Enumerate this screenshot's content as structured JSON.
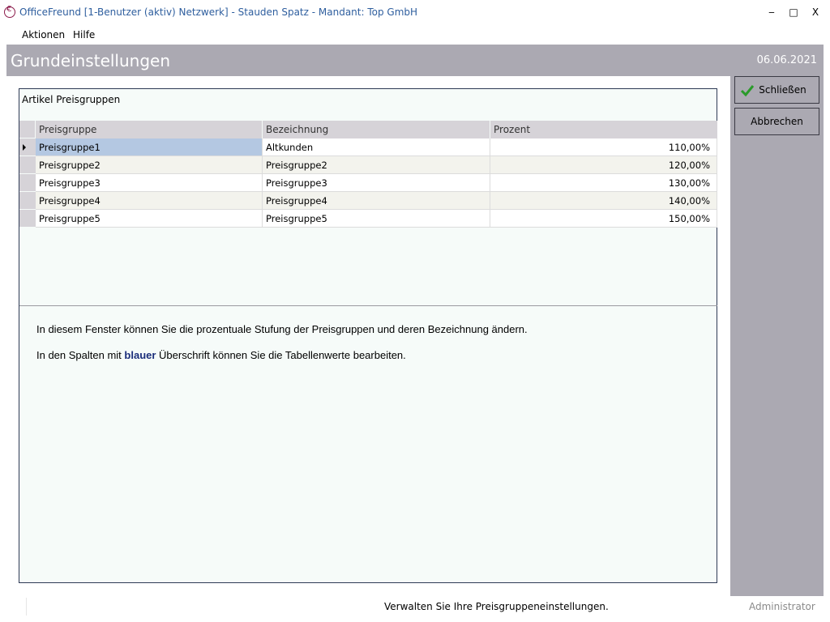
{
  "window": {
    "title": "OfficeFreund [1-Benutzer (aktiv) Netzwerk]  -  Stauden Spatz  -  Mandant: Top GmbH",
    "minimize_glyph": "‒",
    "maximize_glyph": "□",
    "close_glyph": "X"
  },
  "menu": {
    "items": [
      "Aktionen",
      "Hilfe"
    ]
  },
  "header": {
    "title": "Grundeinstellungen",
    "date": "06.06.2021"
  },
  "sidebar": {
    "close_label": "Schließen",
    "cancel_label": "Abbrechen"
  },
  "group": {
    "label": "Artikel Preisgruppen"
  },
  "table": {
    "columns": [
      "Preisgruppe",
      "Bezeichnung",
      "Prozent"
    ],
    "rows": [
      [
        "Preisgruppe1",
        "Altkunden",
        "110,00%"
      ],
      [
        "Preisgruppe2",
        "Preisgruppe2",
        "120,00%"
      ],
      [
        "Preisgruppe3",
        "Preisgruppe3",
        "130,00%"
      ],
      [
        "Preisgruppe4",
        "Preisgruppe4",
        "140,00%"
      ],
      [
        "Preisgruppe5",
        "Preisgruppe5",
        "150,00%"
      ]
    ]
  },
  "info": {
    "line1": "In diesem Fenster können Sie die prozentuale Stufung der Preisgruppen und deren Bezeichnung ändern.",
    "line2_before": "In den Spalten mit ",
    "line2_highlight": "blauer",
    "line2_after": " Überschrift können Sie die Tabellenwerte bearbeiten."
  },
  "status": {
    "message": "Verwalten Sie Ihre Preisgruppeneinstellungen.",
    "user": "Administrator"
  },
  "colors": {
    "accent_header": "#aba9b2",
    "title_text": "#2e5e9e",
    "selected_cell": "#b4c8e2",
    "highlight_text": "#1a2d7a"
  }
}
